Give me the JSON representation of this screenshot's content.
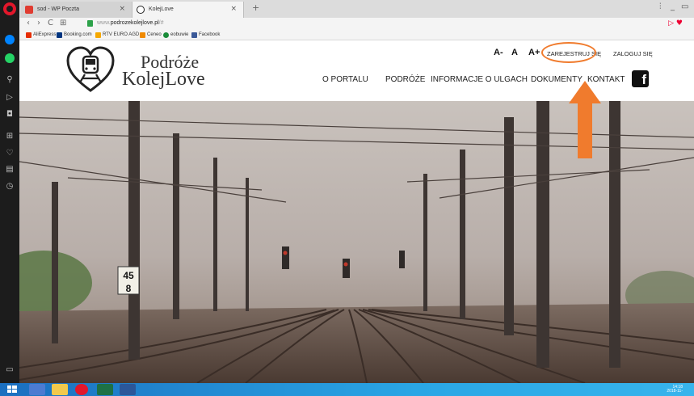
{
  "browser": {
    "tabs": [
      {
        "title": "sod - WP Poczta",
        "active": false,
        "favicon_color": "#e03c31"
      },
      {
        "title": "KolejLove",
        "active": true,
        "favicon_color": "#222222"
      }
    ],
    "new_tab_glyph": "+",
    "nav": {
      "back": "‹",
      "forward": "›",
      "reload": "C",
      "speed_dial": "⊞"
    },
    "url": {
      "prefix": "www.",
      "host": "podrozekolejlove.pl",
      "suffix": "/#"
    },
    "bookmarks": [
      {
        "label": "AliExpress",
        "icon_color": "#e62e04"
      },
      {
        "label": "Booking.com",
        "icon_color": "#003580"
      },
      {
        "label": "RTV EURO AGD",
        "icon_color": "#f5a800"
      },
      {
        "label": "Ceneo",
        "icon_color": "#f08a00"
      },
      {
        "label": "eobuwie",
        "icon_color": "#1a8c3a"
      },
      {
        "label": "Facebook",
        "icon_color": "#3b5998"
      }
    ],
    "sidebar_icons": [
      "messenger-icon",
      "whatsapp-icon",
      "search-icon",
      "send-icon",
      "camera-icon",
      "grid-icon",
      "heart-icon",
      "news-icon",
      "history-icon",
      "panel-icon"
    ],
    "window_controls": {
      "filter": "⫶",
      "minimize": "_",
      "restore": "▭"
    }
  },
  "site": {
    "brand_line1": "Podróże",
    "brand_line2": "KolejLove",
    "font_controls": [
      "A-",
      "A",
      "A+"
    ],
    "register_label": "ZAREJESTRUJ SIĘ",
    "login_label": "ZALOGUJ SIĘ",
    "nav": [
      "O PORTALU",
      "PODRÓŻE",
      "INFORMACJE O ULGACH",
      "DOKUMENTY",
      "KONTAKT"
    ],
    "facebook_glyph": "f",
    "sign_numbers": [
      {
        "top": "45",
        "bottom": "8"
      }
    ],
    "annotation_color": "#f07b2d"
  },
  "taskbar": {
    "time": "14:18",
    "date": "2018-11-"
  }
}
